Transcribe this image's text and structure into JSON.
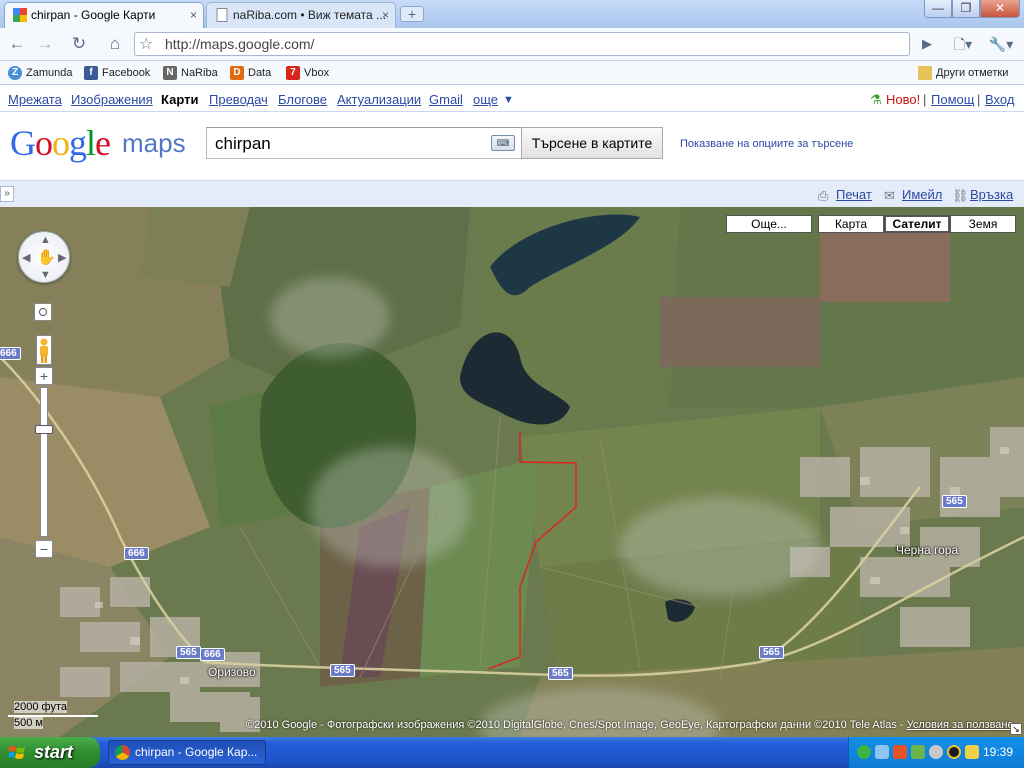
{
  "browser": {
    "tabs": [
      {
        "title": "chirpan - Google Карти",
        "close": "×"
      },
      {
        "title": "naRiba.com • Виж темата ...",
        "close": "×"
      }
    ],
    "new_tab": "+",
    "window_buttons": {
      "minimize": "—",
      "maximize": "❐",
      "close": "✕"
    },
    "url": "http://maps.google.com/",
    "bookmarks": [
      {
        "label": "Zamunda",
        "icon_color": "#4a8ed8",
        "icon_char": "Z"
      },
      {
        "label": "Facebook",
        "icon_color": "#3b5998",
        "icon_char": "f"
      },
      {
        "label": "NaRiba",
        "icon_color": "#666666",
        "icon_char": "N"
      },
      {
        "label": "Data",
        "icon_color": "#e06a0e",
        "icon_char": "D"
      },
      {
        "label": "Vbox",
        "icon_color": "#d8261b",
        "icon_char": "7"
      }
    ],
    "other_bookmarks": "Други отметки"
  },
  "gbar": {
    "links": [
      "Мрежата",
      "Изображения",
      "Карти",
      "Преводач",
      "Блогове",
      "Актуализации",
      "Gmail",
      "още"
    ],
    "more_arrow": "▼",
    "new_label": "Ново!",
    "help": "Помощ",
    "signin": "Вход",
    "separator": "|"
  },
  "header": {
    "logo_letters": [
      "G",
      "o",
      "o",
      "g",
      "l",
      "e"
    ],
    "logo_maps": "maps",
    "search_value": "chirpan",
    "search_button": "Търсене в картите",
    "search_options": "Показване на опциите за търсене"
  },
  "linkbar": {
    "collapse": "»",
    "print": "Печат",
    "email": "Имейл",
    "link": "Връзка"
  },
  "map": {
    "map_types": {
      "more": "Още...",
      "map": "Карта",
      "satellite": "Сателит",
      "earth": "Земя"
    },
    "zoom_in": "+",
    "zoom_out": "−",
    "roads": [
      "666",
      "666",
      "565",
      "666",
      "565",
      "565",
      "565",
      "565",
      "666"
    ],
    "towns": [
      "Черна гора",
      "Оризово"
    ],
    "scale": {
      "imperial": "2000 фута",
      "metric": "500 м"
    },
    "copyright": "©2010 Google - Фотографски изображения ©2010 DigitalGlobe, Cnes/Spot Image, GeoEye, Картографски данни ©2010 Tele Atlas - ",
    "terms": "Условия за ползване"
  },
  "taskbar": {
    "start": "start",
    "task": "chirpan - Google Кар...",
    "clock": "19:39"
  },
  "colors": {
    "link": "#2a4aa4",
    "google_blue": "#3369e8",
    "google_red": "#d50f25",
    "google_yellow": "#eeb211",
    "google_green": "#009925",
    "route": "#e0201b"
  }
}
